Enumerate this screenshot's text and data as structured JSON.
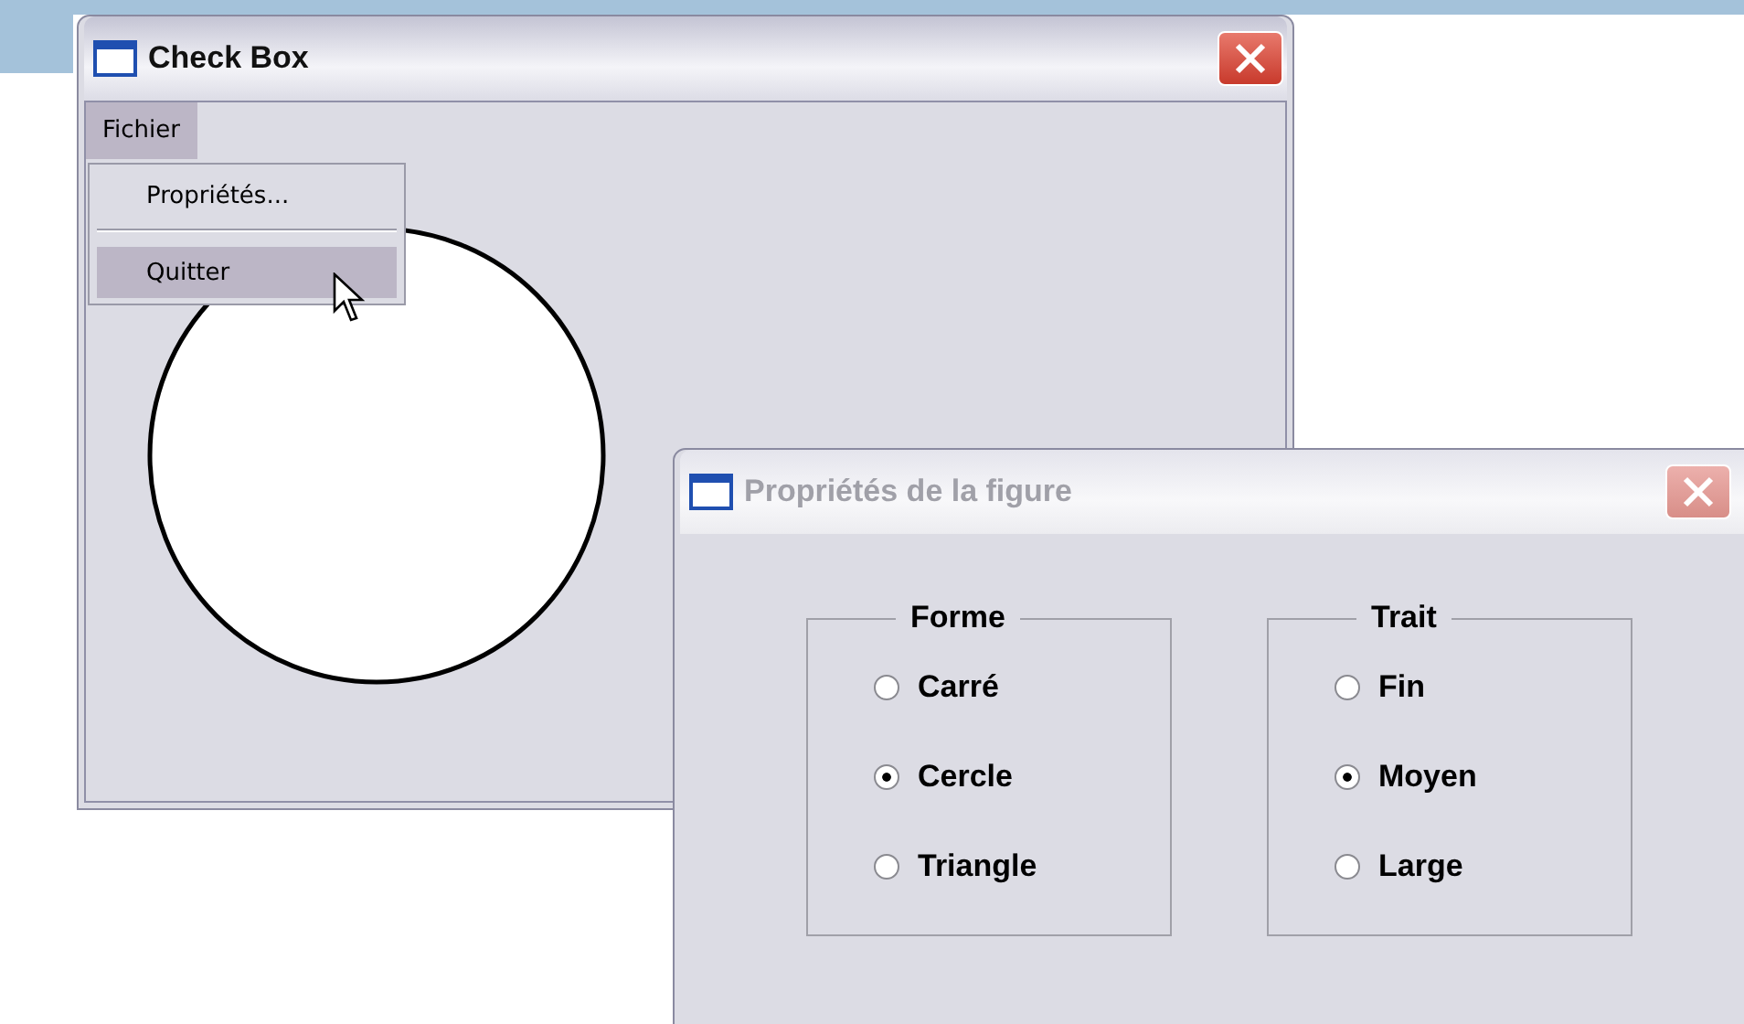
{
  "main_window": {
    "title": "Check Box",
    "active": true,
    "menu_bar": [
      {
        "label": "Fichier",
        "selected": true
      }
    ],
    "menu": [
      {
        "kind": "item",
        "label": "Propriétés...",
        "selected": false
      },
      {
        "kind": "separator"
      },
      {
        "kind": "item",
        "label": "Quitter",
        "selected": true
      }
    ]
  },
  "dialog": {
    "title": "Propriétés de la figure",
    "active": false,
    "groups": [
      {
        "label": "Forme",
        "options": [
          {
            "label": "Carré",
            "selected": false
          },
          {
            "label": "Cercle",
            "selected": true
          },
          {
            "label": "Triangle",
            "selected": false
          }
        ]
      },
      {
        "label": "Trait",
        "options": [
          {
            "label": "Fin",
            "selected": false
          },
          {
            "label": "Moyen",
            "selected": true
          },
          {
            "label": "Large",
            "selected": false
          }
        ]
      }
    ]
  }
}
